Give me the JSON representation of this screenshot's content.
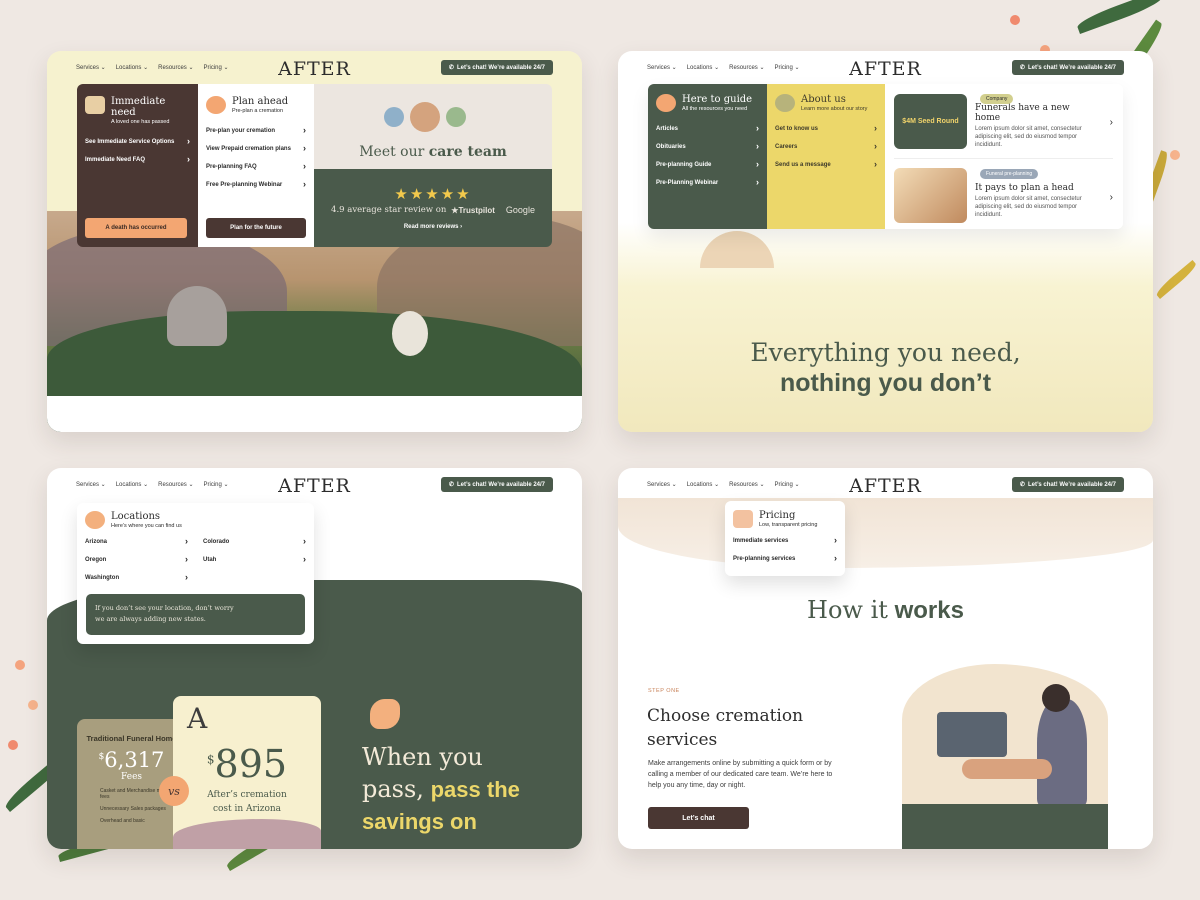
{
  "nav": {
    "links": [
      "Services",
      "Locations",
      "Resources",
      "Pricing"
    ],
    "logo": "AFTER",
    "chat_button": "Let’s chat! We’re available 24/7"
  },
  "card1": {
    "immediate": {
      "title": "Immediate need",
      "subtitle": "A loved one has passed",
      "links": [
        "See Immediate Service Options",
        "Immediate Need FAQ"
      ],
      "button": "A death has occurred"
    },
    "plan": {
      "title": "Plan ahead",
      "subtitle": "Pre-plan a cremation",
      "links": [
        "Pre-plan your cremation",
        "View Prepaid cremation plans",
        "Pre-planning FAQ",
        "Free Pre-planning Webinar"
      ],
      "button": "Plan for the future"
    },
    "team": {
      "heading_pre": "Meet our",
      "heading_bold": "care team",
      "stars": "★★★★★",
      "review_text": "4.9 average star review on",
      "trustpilot": "Trustpilot",
      "google": "Google",
      "read_more": "Read more reviews"
    }
  },
  "card2": {
    "guide": {
      "title": "Here to guide",
      "subtitle": "All the resources you need",
      "links": [
        "Articles",
        "Obituaries",
        "Pre-planning Guide",
        "Pre-Planning Webinar"
      ]
    },
    "about": {
      "title": "About us",
      "subtitle": "Learn more about our story",
      "links": [
        "Get to know us",
        "Careers",
        "Send us a message"
      ]
    },
    "posts": [
      {
        "badge": "Company",
        "thumb": "$4M Seed Round",
        "title": "Funerals have a new home",
        "text": "Lorem ipsum dolor sit amet, consectetur adipiscing elit, sed do eiusmod tempor incididunt."
      },
      {
        "badge": "Funeral pre-planning",
        "thumb": "",
        "title": "It pays to plan a head",
        "text": "Lorem ipsum dolor sit amet, consectetur adipiscing elit, sed do eiusmod tempor incididunt."
      }
    ],
    "headline_1": "Everything you need,",
    "headline_2": "nothing you don’t"
  },
  "card3": {
    "locations": {
      "title": "Locations",
      "subtitle": "Here’s where you can find us",
      "col1": [
        "Arizona",
        "Oregon",
        "Washington"
      ],
      "col2": [
        "Colorado",
        "Utah"
      ],
      "note": "If you don’t see your location, don’t worry we are always adding new states."
    },
    "traditional": {
      "title": "Traditional Funeral Home",
      "currency": "$",
      "price": "6,317",
      "fees": "Fees",
      "items": [
        "Casket and Merchandise markup fees",
        "Unnecessary Sales packages",
        "Overhead and basic"
      ]
    },
    "vs": "vs",
    "after": {
      "currency": "$",
      "price": "895",
      "caption": "After’s cremation cost in Arizona"
    },
    "headline_1": "When you",
    "headline_2": "pass,",
    "headline_3": "pass the",
    "headline_4": "savings on"
  },
  "card4": {
    "pricing": {
      "title": "Pricing",
      "subtitle": "Low, transparent pricing",
      "links": [
        "Immediate services",
        "Pre-planning services"
      ]
    },
    "how_pre": "How it",
    "how_bold": "works",
    "step": "STEP ONE",
    "title": "Choose cremation services",
    "text": "Make arrangements online by submitting a quick form or by calling a member of our dedicated care team. We’re here to help you any time, day or night.",
    "button": "Let’s chat"
  },
  "colors": {
    "green": "#4a5a4b",
    "dark_brown": "#4a3733",
    "peach": "#f3a672",
    "yellow": "#ecd76a",
    "cream": "#f6f2cf"
  }
}
